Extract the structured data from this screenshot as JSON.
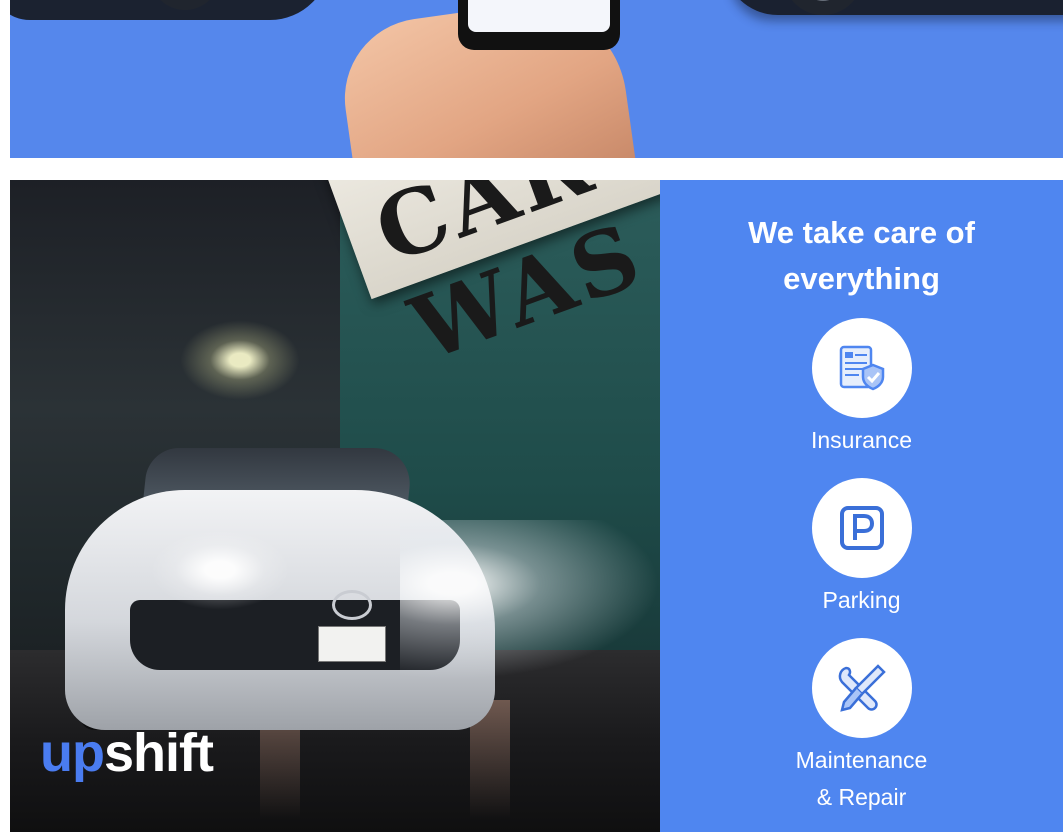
{
  "brand": {
    "logo_part1": "up",
    "logo_part2": "shift",
    "accent": "#4f86f0"
  },
  "photo": {
    "sign_text": "CAR WAS"
  },
  "services": {
    "heading_line1": "We take care of",
    "heading_line2": "everything",
    "items": [
      {
        "label": "Insurance",
        "icon": "insurance-document-shield-icon"
      },
      {
        "label": "Parking",
        "icon": "parking-p-icon"
      },
      {
        "label_line1": "Maintenance",
        "label_line2": "& Repair",
        "icon": "wrench-screwdriver-icon"
      }
    ]
  }
}
